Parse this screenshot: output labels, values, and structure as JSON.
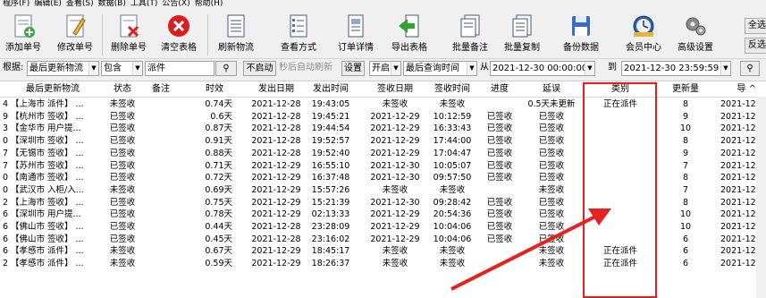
{
  "menu": [
    "程序(F)",
    "编辑(E)",
    "查看(S)",
    "数据(B)",
    "工具(T)",
    "公告(X)",
    "帮助(H)"
  ],
  "toolbar": {
    "add": "添加单号",
    "edit": "修改单号",
    "delete": "删除单号",
    "clear": "清空表格",
    "refresh": "刷新物流",
    "view": "查看方式",
    "detail": "订单详情",
    "export": "导出表格",
    "batch_note": "批量备注",
    "batch_copy": "批量复制",
    "backup": "备份数据",
    "member": "会员中心",
    "settings": "高级设置",
    "select_all": "全选",
    "invert": "反选"
  },
  "filter": {
    "label": "根据:",
    "field": "最后更新物流",
    "op": "包含",
    "value": "派件",
    "not_started": "不启动",
    "auto_refresh_text": "秒后自动刷新",
    "settings_btn": "设置",
    "enable": "开启",
    "time_field": "最后查询时间",
    "from_label": "从",
    "from_value": "2021-12-30 00:00:00",
    "to_label": "到",
    "to_value": "2021-12-30 23:59:59"
  },
  "columns": [
    "最后更新物流",
    "状态",
    "备注",
    "时效",
    "发出日期",
    "发出时间",
    "签收日期",
    "签收时间",
    "进度",
    "延误",
    "类别",
    "更新量",
    "导"
  ],
  "rows": [
    {
      "n": "4",
      "logistics": "【上海市 派件】 ...",
      "status": "未签收",
      "note": "",
      "aging": "0.74天",
      "sdate": "2021-12-28",
      "stime": "19:43:05",
      "rdate": "未签收",
      "rtime": "未签收",
      "prog": "",
      "delay": "0.5天未更新",
      "cat": "正在派件",
      "upd": "8",
      "exp": "2021-12-"
    },
    {
      "n": "9",
      "logistics": "【杭州市 签收】 ...",
      "status": "已签收",
      "note": "",
      "aging": "0.6天",
      "sdate": "2021-12-28",
      "stime": "19:45:21",
      "rdate": "2021-12-29",
      "rtime": "10:12:59",
      "prog": "已签收",
      "delay": "已签收",
      "cat": "",
      "upd": "9",
      "exp": "2021-12-"
    },
    {
      "n": "3",
      "logistics": "【金华市 用户提...",
      "status": "已签收",
      "note": "",
      "aging": "0.87天",
      "sdate": "2021-12-28",
      "stime": "19:44:54",
      "rdate": "2021-12-29",
      "rtime": "16:33:43",
      "prog": "已签收",
      "delay": "已签收",
      "cat": "",
      "upd": "10",
      "exp": "2021-12-"
    },
    {
      "n": "0",
      "logistics": "【深圳市 签收】 ...",
      "status": "已签收",
      "note": "",
      "aging": "0.91天",
      "sdate": "2021-12-28",
      "stime": "19:52:57",
      "rdate": "2021-12-29",
      "rtime": "17:44:00",
      "prog": "已签收",
      "delay": "已签收",
      "cat": "",
      "upd": "8",
      "exp": "2021-12-"
    },
    {
      "n": "7",
      "logistics": "【无锡市 签收】 ...",
      "status": "已签收",
      "note": "",
      "aging": "0.88天",
      "sdate": "2021-12-28",
      "stime": "19:52:40",
      "rdate": "2021-12-29",
      "rtime": "17:04:47",
      "prog": "已签收",
      "delay": "已签收",
      "cat": "",
      "upd": "9",
      "exp": "2021-12-"
    },
    {
      "n": "7",
      "logistics": "【苏州市 签收】 ...",
      "status": "已签收",
      "note": "",
      "aging": "0.71天",
      "sdate": "2021-12-29",
      "stime": "16:55:10",
      "rdate": "2021-12-30",
      "rtime": "10:05:07",
      "prog": "已签收",
      "delay": "已签收",
      "cat": "",
      "upd": "7",
      "exp": "2021-12-"
    },
    {
      "n": "0",
      "logistics": "【南通市 签收】 ...",
      "status": "已签收",
      "note": "",
      "aging": "0.72天",
      "sdate": "2021-12-29",
      "stime": "16:37:48",
      "rdate": "2021-12-30",
      "rtime": "09:57:50",
      "prog": "已签收",
      "delay": "已签收",
      "cat": "",
      "upd": "8",
      "exp": "2021-12-"
    },
    {
      "n": "0",
      "logistics": "【武汉市 入柜/入...",
      "status": "未签收",
      "note": "",
      "aging": "0.69天",
      "sdate": "2021-12-29",
      "stime": "15:57:26",
      "rdate": "未签收",
      "rtime": "未签收",
      "prog": "",
      "delay": "未签收",
      "cat": "",
      "upd": "7",
      "exp": "2021-12-"
    },
    {
      "n": "2",
      "logistics": "【上海市 签收】 ...",
      "status": "已签收",
      "note": "",
      "aging": "0.75天",
      "sdate": "2021-12-29",
      "stime": "15:21:39",
      "rdate": "2021-12-30",
      "rtime": "09:28:42",
      "prog": "已签收",
      "delay": "已签收",
      "cat": "",
      "upd": "8",
      "exp": "2021-12-"
    },
    {
      "n": "6",
      "logistics": "【深圳市 用户提...",
      "status": "已签收",
      "note": "",
      "aging": "0.78天",
      "sdate": "2021-12-29",
      "stime": "02:13:33",
      "rdate": "2021-12-29",
      "rtime": "20:54:36",
      "prog": "已签收",
      "delay": "已签收",
      "cat": "",
      "upd": "10",
      "exp": "2021-12-"
    },
    {
      "n": "6",
      "logistics": "【佛山市 签收】 ...",
      "status": "已签收",
      "note": "",
      "aging": "0.44天",
      "sdate": "2021-12-28",
      "stime": "23:28:09",
      "rdate": "2021-12-29",
      "rtime": "10:04:06",
      "prog": "已签收",
      "delay": "已签收",
      "cat": "",
      "upd": "10",
      "exp": "2021-12-"
    },
    {
      "n": "6",
      "logistics": "【佛山市 签收】 ...",
      "status": "已签收",
      "note": "",
      "aging": "0.45天",
      "sdate": "2021-12-28",
      "stime": "23:16:02",
      "rdate": "2021-12-29",
      "rtime": "10:04:06",
      "prog": "已签收",
      "delay": "已签收",
      "cat": "",
      "upd": "6",
      "exp": "2021-12-"
    },
    {
      "n": "6",
      "logistics": "【孝感市 派件】 ...",
      "status": "未签收",
      "note": "",
      "aging": "0.67天",
      "sdate": "2021-12-29",
      "stime": "18:45:17",
      "rdate": "未签收",
      "rtime": "未签收",
      "prog": "",
      "delay": "未签收",
      "cat": "正在派件",
      "upd": "6",
      "exp": "2021-12-"
    },
    {
      "n": "2",
      "logistics": "【孝感市 派件】 ...",
      "status": "未签收",
      "note": "",
      "aging": "0.59天",
      "sdate": "2021-12-29",
      "stime": "18:26:37",
      "rdate": "未签收",
      "rtime": "未签收",
      "prog": "",
      "delay": "未签收",
      "cat": "正在派件",
      "upd": "6",
      "exp": "2021-12-"
    }
  ],
  "colors": {
    "highlight_box": "#e02020",
    "arrow": "#e52222"
  },
  "icons": [
    "add-icon",
    "edit-pencil-icon",
    "delete-icon",
    "clear-red-x-icon",
    "refresh-doc-icon",
    "view-list-icon",
    "detail-doc-icon",
    "export-green-arrow-icon",
    "batch-note-doc-icon",
    "batch-copy-doc-icon",
    "floppy-disk-icon",
    "clock-member-icon",
    "gear-icon",
    "search-icon"
  ]
}
